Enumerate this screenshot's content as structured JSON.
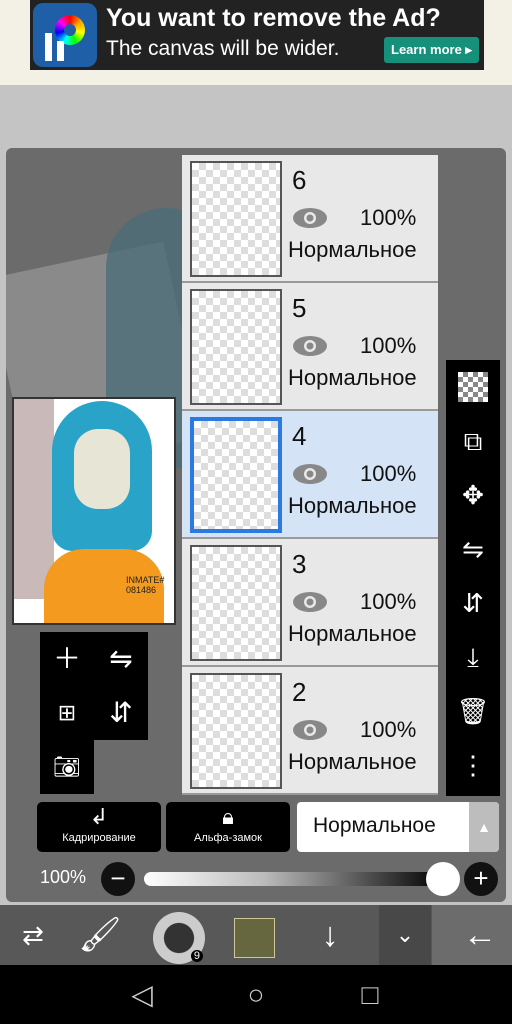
{
  "ad": {
    "title": "You want to remove the Ad?",
    "subtitle": "The canvas will be wider.",
    "button": "Learn more ▸"
  },
  "layers": [
    {
      "number": "6",
      "opacity": "100%",
      "mode": "Нормальное",
      "visible": true,
      "selected": false
    },
    {
      "number": "5",
      "opacity": "100%",
      "mode": "Нормальное",
      "visible": true,
      "selected": false
    },
    {
      "number": "4",
      "opacity": "100%",
      "mode": "Нормальное",
      "visible": true,
      "selected": true
    },
    {
      "number": "3",
      "opacity": "100%",
      "mode": "Нормальное",
      "visible": true,
      "selected": false
    },
    {
      "number": "2",
      "opacity": "100%",
      "mode": "Нормальное",
      "visible": true,
      "selected": false
    }
  ],
  "buttons": {
    "clip": "Кадрирование",
    "alpha_lock": "Альфа-замок",
    "blend_mode": "Нормальное"
  },
  "opacity": {
    "label": "100%",
    "value": 100
  },
  "brush_size": "9",
  "colors": {
    "accent": "#2a7ae2",
    "current_color": "#66663f",
    "panel": "#6b6b6b"
  },
  "preview_text": "INMATE# 081486"
}
